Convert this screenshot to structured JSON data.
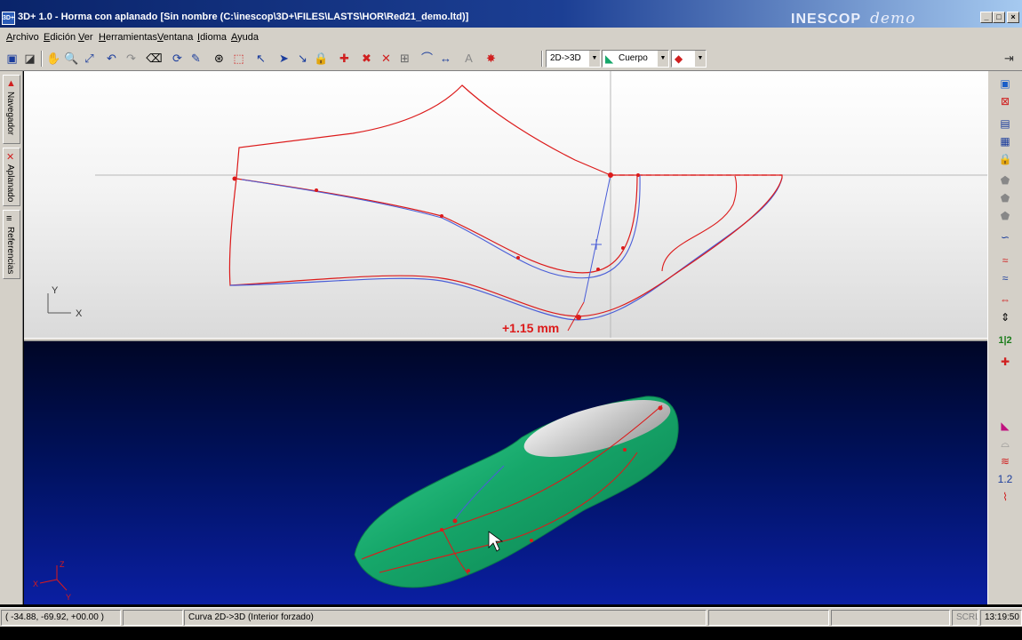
{
  "window": {
    "title": "3D+ 1.0 - Horma con aplanado [Sin nombre (C:\\inescop\\3D+\\FILES\\LASTS\\HOR\\Red21_demo.ltd)]",
    "brand": "INESCOP",
    "brand_suffix": "demo",
    "app_icon": "3D+"
  },
  "menu": [
    "Archivo",
    "Edición",
    "Ver",
    "Herramientas",
    "Ventana",
    "Idioma",
    "Ayuda"
  ],
  "toolbar": {
    "mode_combo": "2D->3D",
    "object_combo": "Cuerpo"
  },
  "left_panels": [
    "Navegador",
    "Aplanado",
    "Referencias"
  ],
  "view2d": {
    "axis_y": "Y",
    "axis_x": "X",
    "measure_label": "+1.15 mm"
  },
  "view3d": {
    "axis_z": "Z",
    "axis_y": "Y",
    "axis_x": "X"
  },
  "right_labels": {
    "one_two_top": "1|2",
    "one_two_bottom": "1.2"
  },
  "status": {
    "coords": "( -34.88, -69.92, +00.00 )",
    "message": "Curva 2D->3D (Interior forzado)",
    "scrl": "SCRL",
    "time": "13:19:50"
  },
  "colors": {
    "curve_red": "#dc1a1a",
    "curve_blue": "#4a5ed8",
    "last_green": "#16a76a",
    "viewport_blue": "#0a1fa2"
  }
}
